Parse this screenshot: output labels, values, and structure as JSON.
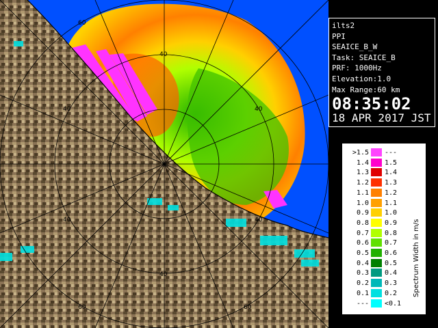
{
  "info": {
    "lines": [
      "ilts2",
      "PPI",
      "SEAICE_B_W",
      "Task: SEAICE_B",
      "PRF: 1000Hz",
      "Elevation:1.0",
      "Max Range:60 km"
    ],
    "time": "08:35:02",
    "date": "18 APR 2017 JST"
  },
  "legend": {
    "unit": "Spectrum Width in m/s",
    "rows": [
      {
        "left": ">1.5",
        "right": "---",
        "color": "#ff44ff"
      },
      {
        "left": "1.4",
        "right": "1.5",
        "color": "#ff00cc"
      },
      {
        "left": "1.3",
        "right": "1.4",
        "color": "#e00000"
      },
      {
        "left": "1.2",
        "right": "1.3",
        "color": "#ff3000"
      },
      {
        "left": "1.1",
        "right": "1.2",
        "color": "#ff8000"
      },
      {
        "left": "1.0",
        "right": "1.1",
        "color": "#ffa000"
      },
      {
        "left": "0.9",
        "right": "1.0",
        "color": "#ffd000"
      },
      {
        "left": "0.8",
        "right": "0.9",
        "color": "#ffff00"
      },
      {
        "left": "0.7",
        "right": "0.8",
        "color": "#b0ff00"
      },
      {
        "left": "0.6",
        "right": "0.7",
        "color": "#60e000"
      },
      {
        "left": "0.5",
        "right": "0.6",
        "color": "#20b000"
      },
      {
        "left": "0.4",
        "right": "0.5",
        "color": "#008000"
      },
      {
        "left": "0.3",
        "right": "0.4",
        "color": "#009a80"
      },
      {
        "left": "0.2",
        "right": "0.3",
        "color": "#00b8b8"
      },
      {
        "left": "0.1",
        "right": "0.2",
        "color": "#00e0e0"
      },
      {
        "left": "---",
        "right": "<0.1",
        "color": "#00ffff"
      }
    ]
  },
  "map": {
    "range_labels": [
      "20",
      "40",
      "60"
    ],
    "colors": {
      "sea": "#0050ff",
      "land": "#8b7355",
      "rings": "#000000"
    }
  }
}
